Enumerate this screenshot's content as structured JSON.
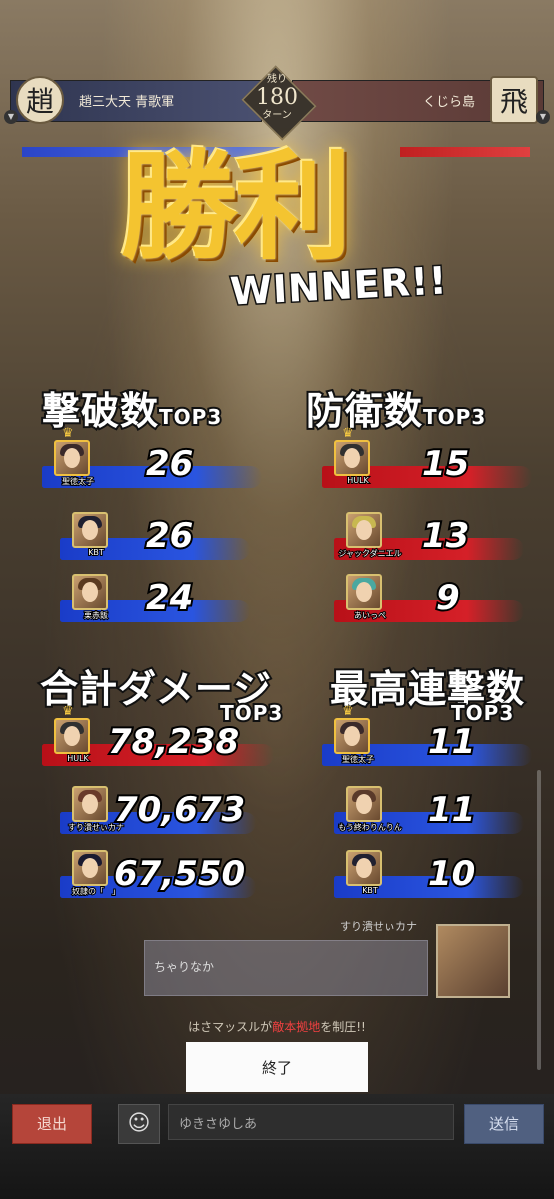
{
  "header": {
    "left_team": "趙三大天 青歌軍",
    "left_crest": "趙",
    "right_team": "くじら島",
    "right_crest": "飛",
    "turns_label_top": "残り",
    "turns_value": "180",
    "turns_label_bottom": "ターン"
  },
  "result": {
    "title_kanji": "勝利",
    "title_en": "WINNER!!"
  },
  "sections": {
    "defeats": {
      "title": "撃破数",
      "badge": "TOP3",
      "rows": [
        {
          "name": "聖徳太子",
          "value": "26",
          "crown": "♛"
        },
        {
          "name": "KBT",
          "value": "26"
        },
        {
          "name": "栗赤飯",
          "value": "24"
        }
      ]
    },
    "defense": {
      "title": "防衛数",
      "badge": "TOP3",
      "rows": [
        {
          "name": "HULK",
          "value": "15",
          "crown": "♛"
        },
        {
          "name": "ジャックダニエル",
          "value": "13"
        },
        {
          "name": "あいっぺ",
          "value": "9"
        }
      ]
    },
    "damage": {
      "title": "合計ダメージ",
      "badge": "TOP3",
      "rows": [
        {
          "name": "HULK",
          "value": "78,238",
          "crown": "♛"
        },
        {
          "name": "すり潰せぃカナ",
          "value": "70,673"
        },
        {
          "name": "奴隷の「　」",
          "value": "67,550"
        }
      ]
    },
    "combo": {
      "title": "最高連撃数",
      "badge": "TOP3",
      "rows": [
        {
          "name": "聖徳太子",
          "value": "11",
          "crown": "♛"
        },
        {
          "name": "もう終わりんりん",
          "value": "11"
        },
        {
          "name": "KBT",
          "value": "10"
        }
      ]
    }
  },
  "chat": {
    "sender": "すり潰せぃカナ",
    "message": "ちゃりなか",
    "notice_player": "はさマッスル",
    "notice_mid": "が",
    "notice_target": "敵本拠地",
    "notice_end": "を制圧!!"
  },
  "buttons": {
    "end": "終了",
    "exit": "退出",
    "emoji": "☺",
    "send": "送信"
  },
  "input": {
    "message_value": "ゆきさゆしあ"
  },
  "colors": {
    "blue_team": "#2a55e0",
    "red_team": "#d52028",
    "gold": "#f4c430"
  }
}
